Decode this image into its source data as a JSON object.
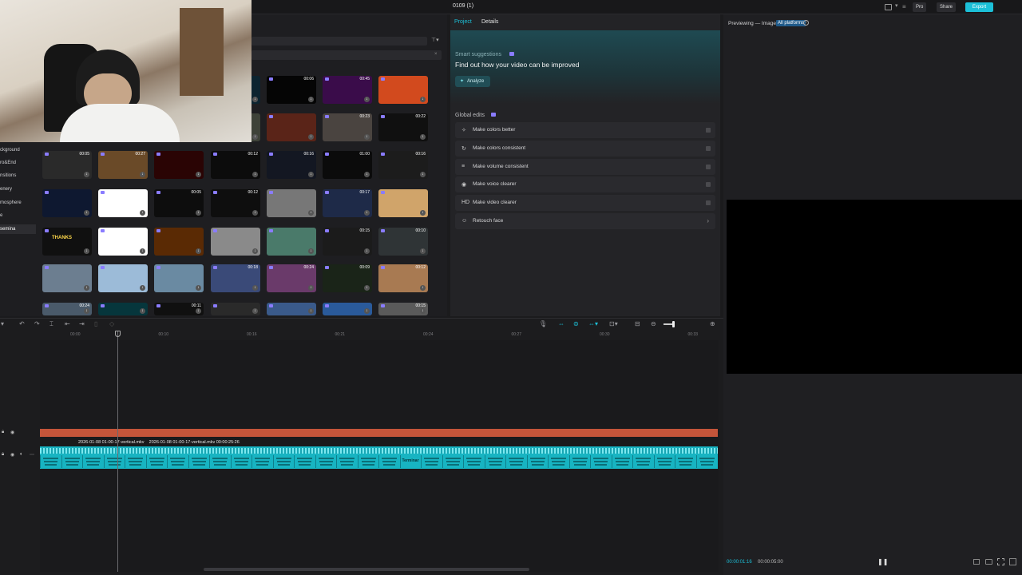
{
  "topbar": {
    "title": "0109 (1)",
    "pro": "Pro",
    "share": "Share",
    "export": "Export"
  },
  "media": {
    "categories": [
      "ckground",
      "ro&End",
      "nsitions",
      "enery",
      "mosphere",
      "e",
      "semina"
    ],
    "thumbs": [
      {
        "dur": "",
        "bg": "#0c2430"
      },
      {
        "dur": "00:06",
        "bg": "#050505"
      },
      {
        "dur": "00:45",
        "bg": "#3a0c4a"
      },
      {
        "dur": "",
        "bg": "#d24a1e"
      },
      {
        "dur": "",
        "bg": "#3e4238"
      },
      {
        "dur": "",
        "bg": "#5a2418"
      },
      {
        "dur": "00:23",
        "bg": "#4a4440"
      },
      {
        "dur": "00:22",
        "bg": "#101010"
      },
      {
        "dur": "00:05",
        "bg": "#2a2a2a"
      },
      {
        "dur": "00:27",
        "bg": "#6a4a28"
      },
      {
        "dur": "",
        "bg": "#2a0404"
      },
      {
        "dur": "00:12",
        "bg": "#0c0c0c"
      },
      {
        "dur": "00:16",
        "bg": "#131722"
      },
      {
        "dur": "01:00",
        "bg": "#0b0b0b"
      },
      {
        "dur": "00:16",
        "bg": "#1c1c1c"
      },
      {
        "dur": "",
        "bg": "#0e1830"
      },
      {
        "dur": "",
        "bg": "#ffffff"
      },
      {
        "dur": "00:05",
        "bg": "#0d0d0d"
      },
      {
        "dur": "00:12",
        "bg": "#0e0e0e"
      },
      {
        "dur": "",
        "bg": "#777777"
      },
      {
        "dur": "00:17",
        "bg": "#1e2a48"
      },
      {
        "dur": "",
        "bg": "#d0a46a"
      },
      {
        "dur": "",
        "bg": "#101010",
        "text": "THANKS"
      },
      {
        "dur": "",
        "bg": "#ffffff"
      },
      {
        "dur": "",
        "bg": "#5a2a04"
      },
      {
        "dur": "",
        "bg": "#8a8a8a"
      },
      {
        "dur": "",
        "bg": "#4a7a6a"
      },
      {
        "dur": "00:15",
        "bg": "#1b1b1b"
      },
      {
        "dur": "00:10",
        "bg": "#2f3436"
      },
      {
        "dur": "",
        "bg": "#6c7e90"
      },
      {
        "dur": "",
        "bg": "#9cbbd8"
      },
      {
        "dur": "",
        "bg": "#6a8aa2"
      },
      {
        "dur": "00:18",
        "bg": "#3a4a78"
      },
      {
        "dur": "00:24",
        "bg": "#6a3a6a"
      },
      {
        "dur": "00:09",
        "bg": "#1a2418"
      },
      {
        "dur": "00:12",
        "bg": "#a87a52"
      },
      {
        "dur": "00:24",
        "bg": "#4a5a6a"
      },
      {
        "dur": "",
        "bg": "#06363c"
      },
      {
        "dur": "00:11",
        "bg": "#101010"
      },
      {
        "dur": "",
        "bg": "#2a2a2a"
      },
      {
        "dur": "",
        "bg": "#3a5a8a"
      },
      {
        "dur": "",
        "bg": "#2a5a9a"
      },
      {
        "dur": "00:15",
        "bg": "#5a5a5a"
      }
    ]
  },
  "right": {
    "tab_project": "Project",
    "tab_details": "Details",
    "smart_title": "Smart suggestions",
    "smart_heading": "Find out how your video can be improved",
    "analyze": "Analyze",
    "global_title": "Global edits",
    "items": [
      {
        "icon": "✧",
        "label": "Make colors better"
      },
      {
        "icon": "↻",
        "label": "Make colors consistent"
      },
      {
        "icon": "≡",
        "label": "Make volume consistent"
      },
      {
        "icon": "◉",
        "label": "Make voice clearer"
      },
      {
        "icon": "HD",
        "label": "Make video clearer"
      },
      {
        "icon": "☺",
        "label": "Retouch face"
      }
    ]
  },
  "preview": {
    "label": "Previewing — Image",
    "platform": "All platforms",
    "time_current": "00:00:01:16",
    "time_total": "00:00:05:00"
  },
  "timeline": {
    "ruler": [
      "00:00",
      "00:10",
      "00:16",
      "00:21",
      "00:24",
      "00:27",
      "00:30",
      "00:33"
    ],
    "clip_label1": "2026-01-08 01-00-17-vertical.mkv",
    "clip_label2": "2026-01-08 01-00-17-vertical.mkv  00:00:25:26",
    "seg_text": "Terminar"
  },
  "colors": {
    "accent": "#1cc0d8",
    "red_track": "#c4553a",
    "clip": "#17b4c2"
  }
}
